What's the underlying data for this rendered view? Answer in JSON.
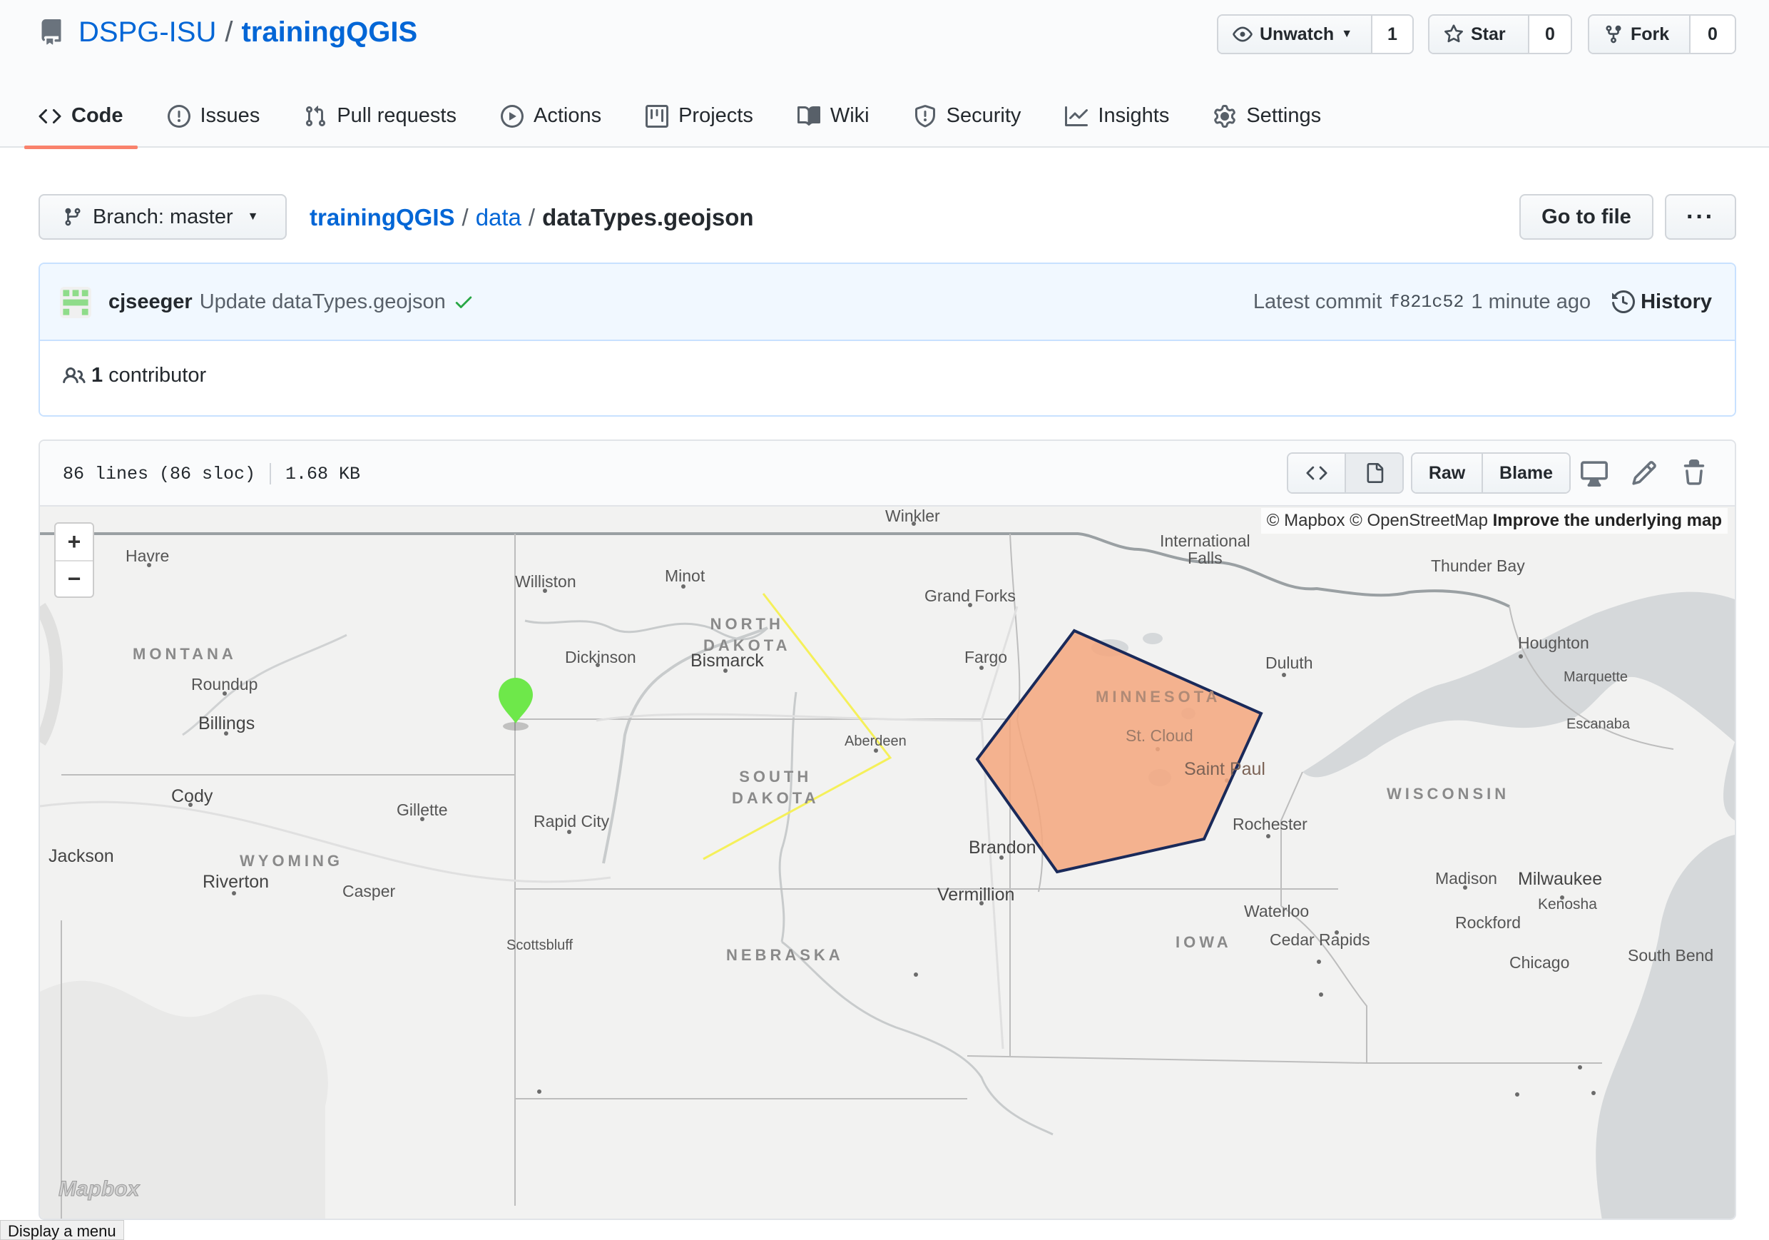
{
  "repo": {
    "owner": "DSPG-ISU",
    "separator": "/",
    "name": "trainingQGIS"
  },
  "actions": {
    "watch": {
      "label": "Unwatch",
      "count": "1"
    },
    "star": {
      "label": "Star",
      "count": "0"
    },
    "fork": {
      "label": "Fork",
      "count": "0"
    }
  },
  "tabs": [
    {
      "label": "Code",
      "icon": "code-icon"
    },
    {
      "label": "Issues",
      "icon": "issue-icon"
    },
    {
      "label": "Pull requests",
      "icon": "pull-request-icon"
    },
    {
      "label": "Actions",
      "icon": "play-icon"
    },
    {
      "label": "Projects",
      "icon": "project-icon"
    },
    {
      "label": "Wiki",
      "icon": "book-icon"
    },
    {
      "label": "Security",
      "icon": "shield-icon"
    },
    {
      "label": "Insights",
      "icon": "graph-icon"
    },
    {
      "label": "Settings",
      "icon": "gear-icon"
    }
  ],
  "branch": {
    "label": "Branch: master"
  },
  "breadcrumb": {
    "root": "trainingQGIS",
    "folder": "data",
    "file": "dataTypes.geojson",
    "sep": "/"
  },
  "buttons": {
    "go_to_file": "Go to file",
    "more": "···",
    "raw": "Raw",
    "blame": "Blame"
  },
  "commit": {
    "user": "cjseeger",
    "message": "Update dataTypes.geojson",
    "latest_label": "Latest commit",
    "sha": "f821c52",
    "time": "1 minute ago",
    "history": "History"
  },
  "contributors": {
    "count": "1",
    "label": "contributor"
  },
  "file": {
    "lines": "86 lines (86 sloc)",
    "size": "1.68 KB"
  },
  "map": {
    "attribution": "© Mapbox © OpenStreetMap",
    "attribution_link": "Improve the underlying map",
    "zoom_in": "+",
    "zoom_out": "−",
    "logo": "Mapbox",
    "colors": {
      "polygon_fill": "#f4a77e",
      "polygon_stroke": "#1a2a5a",
      "line": "#f5f05a",
      "marker": "#6ee84a",
      "water": "#d5d8da"
    },
    "labels": {
      "winkler": "Winkler",
      "intl_falls": "International\nFalls",
      "thunder_bay": "Thunder Bay",
      "havre": "Havre",
      "williston": "Williston",
      "minot": "Minot",
      "grand_forks": "Grand Forks",
      "north_dakota": "NORTH\nDAKOTA",
      "montana": "MONTANA",
      "dickinson": "Dickinson",
      "bismarck": "Bismarck",
      "fargo": "Fargo",
      "houghton": "Houghton",
      "duluth": "Duluth",
      "marquette": "Marquette",
      "roundup": "Roundup",
      "minnesota": "MINNESOTA",
      "billings": "Billings",
      "aberdeen": "Aberdeen",
      "st_cloud": "St. Cloud",
      "escanaba": "Escanaba",
      "saint_paul": "Saint Paul",
      "south_dakota": "SOUTH\nDAKOTA",
      "wisconsin": "WISCONSIN",
      "cody": "Cody",
      "gillette": "Gillette",
      "rapid_city": "Rapid City",
      "rochester": "Rochester",
      "brandon": "Brandon",
      "jackson": "Jackson",
      "wyoming": "WYOMING",
      "riverton": "Riverton",
      "casper": "Casper",
      "vermillion": "Vermillion",
      "madison": "Madison",
      "milwaukee": "Milwaukee",
      "kenosha": "Kenosha",
      "waterloo": "Waterloo",
      "rockford": "Rockford",
      "cedar_rapids": "Cedar Rapids",
      "iowa": "IOWA",
      "scottsbluff": "Scottsbluff",
      "nebraska": "NEBRASKA",
      "chicago": "Chicago",
      "south_bend": "South Bend"
    }
  },
  "tooltip": "Display a menu"
}
